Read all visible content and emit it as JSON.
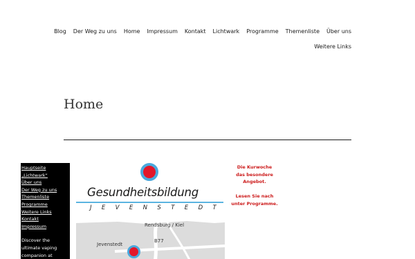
{
  "nav": {
    "row1": [
      "Blog",
      "Der Weg zu uns",
      "Home",
      "Impressum",
      "Kontakt",
      "Lichtwark",
      "Programme",
      "Themenliste",
      "Über uns"
    ],
    "row2": [
      "Weitere Links"
    ]
  },
  "page": {
    "title": "Home"
  },
  "sidebar": {
    "links": [
      "Hauptseite",
      "„Lichtwark“",
      "Über uns",
      "Der Weg zu uns",
      "Themenliste",
      "Programme",
      "Weitere Links",
      "Kontakt",
      "Impressum"
    ],
    "promo_lines": [
      "Discover the",
      "ultimate vaping",
      "companion at"
    ]
  },
  "logo": {
    "title": "Gesundheitsbildung",
    "subtitle": "JEVENSTEDT",
    "accent_red": "#e3172a",
    "accent_blue": "#4aa9dd"
  },
  "map": {
    "labels": [
      "Rendsburg / Kiel",
      "B77",
      "Jevenstedt"
    ]
  },
  "notice": {
    "paragraph1": [
      "Die Kurwoche",
      "das besondere",
      "Angebot."
    ],
    "paragraph2": [
      "Lesen Sie nach",
      "unter Programme."
    ],
    "color": "#cc1a1a"
  }
}
